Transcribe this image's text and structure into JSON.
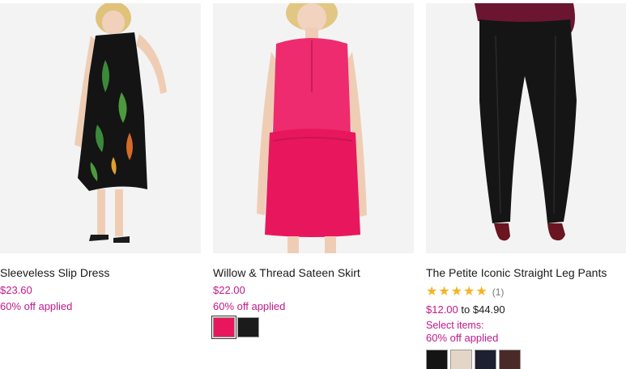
{
  "products": [
    {
      "title": "Sleeveless Slip Dress",
      "price": "$23.60",
      "promo": "60% off applied",
      "image": "floral-black-dress-photo"
    },
    {
      "title": "Willow & Thread Sateen Skirt",
      "price": "$22.00",
      "promo": "60% off applied",
      "image": "pink-sateen-skirt-photo",
      "swatches": [
        "#e8175d",
        "#1b1b1b"
      ]
    },
    {
      "title": "The Petite Iconic Straight Leg Pants",
      "rating_count": "(1)",
      "rating_value": 5,
      "price_low": "$12.00",
      "price_to": "to",
      "price_high": "$44.90",
      "select_items": "Select items:",
      "promo": "60% off applied",
      "image": "black-straight-pants-photo",
      "swatches": [
        "#141414",
        "#e4d6c6",
        "#1c2030",
        "#4a2a28"
      ]
    }
  ],
  "colors": {
    "accent": "#c2188a",
    "star": "#f5b324"
  }
}
